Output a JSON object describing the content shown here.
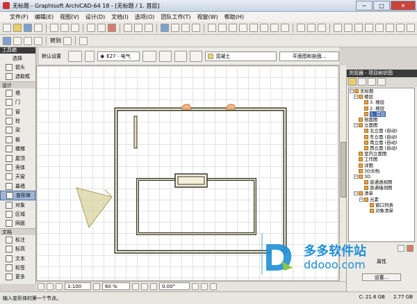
{
  "window": {
    "title": "无标题 - Graphisoft ArchiCAD-64 18 - [无标题 / 1. 首层]",
    "minimize": "─",
    "maximize": "□",
    "close": "✕"
  },
  "menu": [
    "文件(F)",
    "编辑(E)",
    "视图(V)",
    "设计(D)",
    "文档(I)",
    "选项(O)",
    "团队工作(T)",
    "视窗(W)",
    "帮助(H)"
  ],
  "toolbar2": {
    "zoom_to": "转到"
  },
  "infobox": {
    "default_label": "默认设置",
    "layer": "E27 - 电气",
    "material": "混凝土",
    "plan_section": "平面图和剖面..."
  },
  "toolbox": {
    "title": "工具箱",
    "top_label": "选择",
    "sections": [
      {
        "name": "",
        "items": [
          "箭头",
          "选取框"
        ]
      },
      {
        "name": "设计",
        "items": [
          "墙",
          "门",
          "窗",
          "柱",
          "梁",
          "板",
          "楼梯",
          "屋顶",
          "壳体",
          "天窗",
          "幕墙",
          "变形体",
          "对象",
          "区域",
          "网面"
        ]
      },
      {
        "name": "文档",
        "items": [
          "标注",
          "标高",
          "文本",
          "标签"
        ]
      },
      {
        "name": "",
        "items": [
          "更多"
        ]
      }
    ],
    "selected": "变形体"
  },
  "navigator": {
    "title": "浏览器 - 项目树状图",
    "tree": [
      {
        "label": "无标题",
        "level": 0
      },
      {
        "label": "楼层",
        "level": 1
      },
      {
        "label": "3. 楼层",
        "level": 2
      },
      {
        "label": "2. 楼层",
        "level": 2
      },
      {
        "label": "1. 首层",
        "level": 2,
        "selected": true
      },
      {
        "label": "剖面图",
        "level": 1
      },
      {
        "label": "立面图",
        "level": 1
      },
      {
        "label": "北立面 (自动)",
        "level": 2
      },
      {
        "label": "东立面 (自动)",
        "level": 2
      },
      {
        "label": "南立面 (自动)",
        "level": 2
      },
      {
        "label": "西立面 (自动)",
        "level": 2
      },
      {
        "label": "室内立面图",
        "level": 1
      },
      {
        "label": "工作图",
        "level": 1
      },
      {
        "label": "详图",
        "level": 1
      },
      {
        "label": "3D文档",
        "level": 1
      },
      {
        "label": "3D",
        "level": 1
      },
      {
        "label": "普通透视图",
        "level": 2
      },
      {
        "label": "普通轴测图",
        "level": 2
      },
      {
        "label": "清单",
        "level": 1
      },
      {
        "label": "元素",
        "level": 2
      },
      {
        "label": "窗口列表",
        "level": 3
      },
      {
        "label": "对象清单",
        "level": 3
      }
    ],
    "properties": "属性",
    "settings": "设置..."
  },
  "status_bar": {
    "scale": "1:100",
    "zoom": "60 %",
    "angle": "0.00°",
    "c_drive": "C: 21.6 GB",
    "memory": "2.77 GB",
    "hint": "输入变形体的第一个节点。"
  },
  "watermark": {
    "brand": "多多软件站",
    "url": "ddooo.com"
  }
}
